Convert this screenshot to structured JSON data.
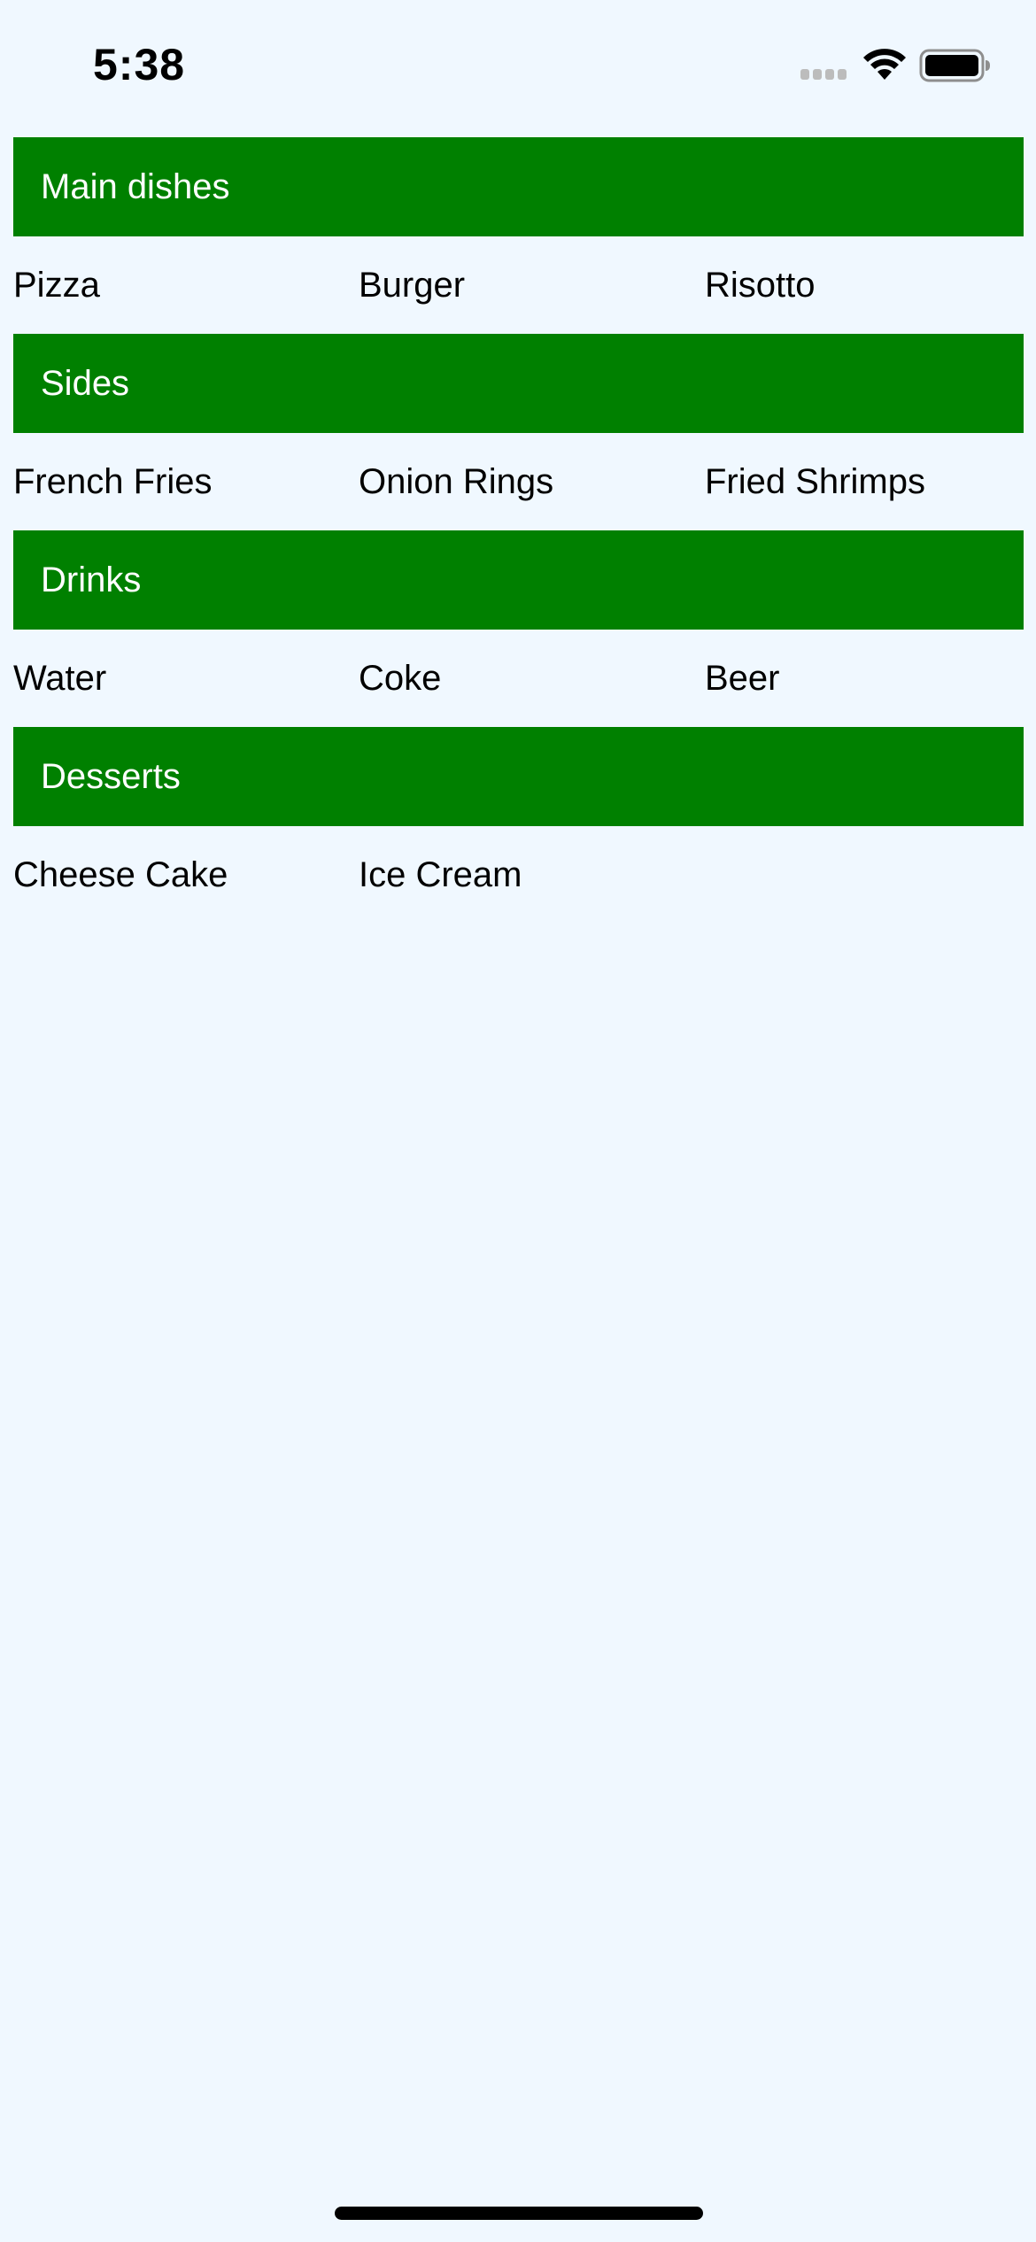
{
  "status_bar": {
    "time": "5:38",
    "icons": [
      "cellular-signal-icon",
      "wifi-icon",
      "battery-icon"
    ]
  },
  "theme": {
    "background": "#f0f8ff",
    "header_background": "#008000",
    "header_text": "#ffffff",
    "item_text": "#000000"
  },
  "sections": [
    {
      "title": "Main dishes",
      "items": [
        "Pizza",
        "Burger",
        "Risotto"
      ]
    },
    {
      "title": "Sides",
      "items": [
        "French Fries",
        "Onion Rings",
        "Fried Shrimps"
      ]
    },
    {
      "title": "Drinks",
      "items": [
        "Water",
        "Coke",
        "Beer"
      ]
    },
    {
      "title": "Desserts",
      "items": [
        "Cheese Cake",
        "Ice Cream"
      ]
    }
  ]
}
